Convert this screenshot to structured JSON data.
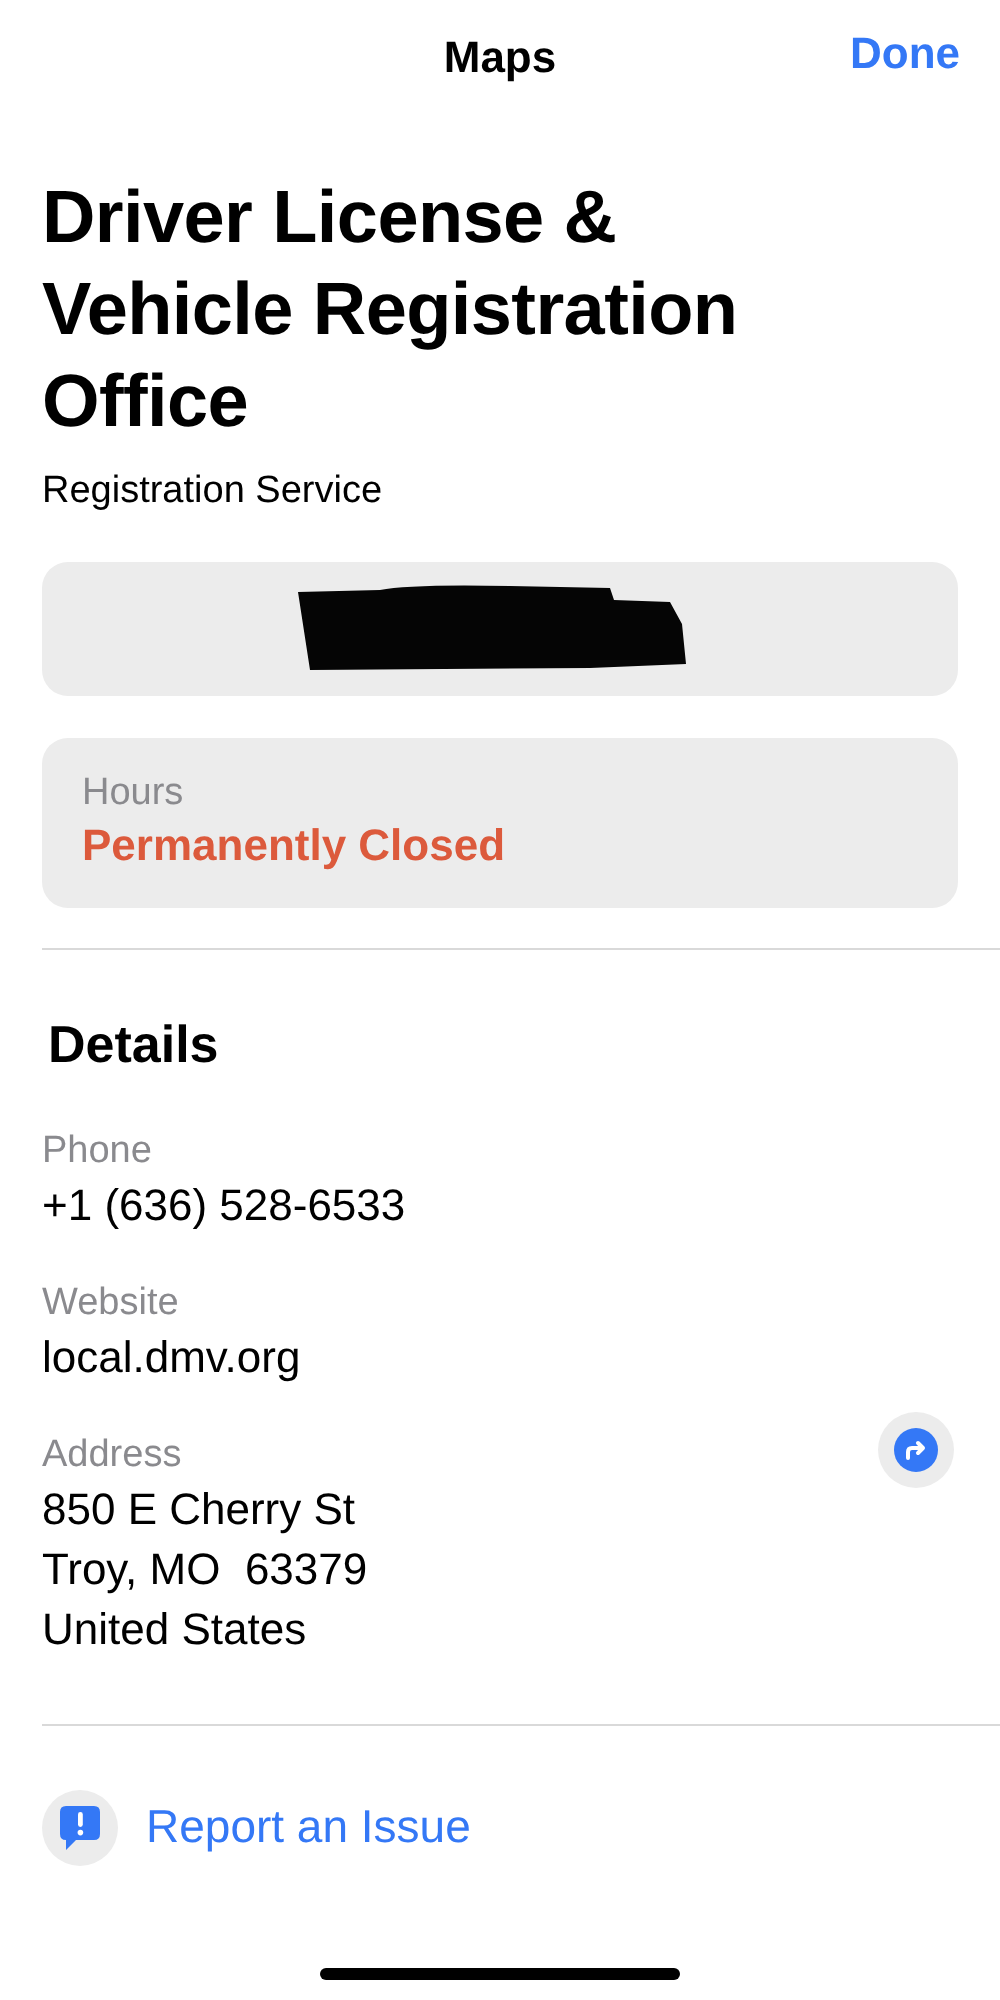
{
  "header": {
    "title": "Maps",
    "done_button": "Done"
  },
  "place": {
    "name": "Driver License & Vehicle Registration Office",
    "category": "Registration Service"
  },
  "cards": [
    {
      "kind": "redacted"
    },
    {
      "kind": "hours",
      "label": "Hours",
      "value": "Permanently Closed"
    }
  ],
  "details": {
    "heading": "Details",
    "fields": [
      {
        "label": "Phone",
        "lines": [
          "+1 (636) 528-6533"
        ],
        "directions": false
      },
      {
        "label": "Website",
        "lines": [
          "local.dmv.org"
        ],
        "directions": false
      },
      {
        "label": "Address",
        "lines": [
          "850 E Cherry St",
          "Troy, MO  63379",
          "United States"
        ],
        "directions": true
      }
    ]
  },
  "report": {
    "label": "Report an Issue"
  }
}
